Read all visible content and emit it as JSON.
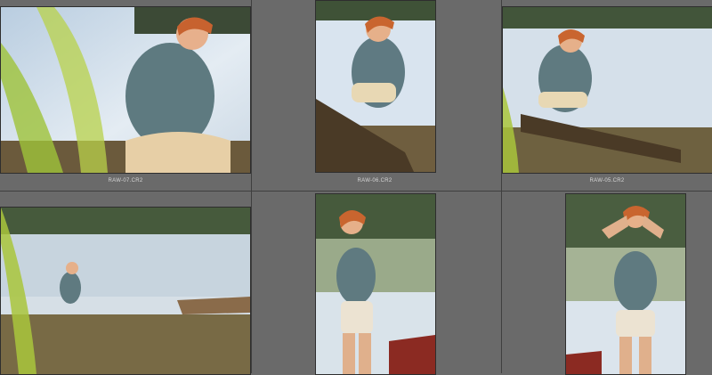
{
  "grid": {
    "background_color": "#6a6a6a",
    "separator_color": "#3f3f3f",
    "cells": [
      {
        "filename": "RAW-07.CR2",
        "orientation": "landscape",
        "selected": false
      },
      {
        "filename": "RAW-06.CR2",
        "orientation": "landscape",
        "selected": false
      },
      {
        "filename": "RAW-05.CR2",
        "orientation": "landscape",
        "selected": false
      },
      {
        "filename": "",
        "orientation": "landscape",
        "selected": false
      },
      {
        "filename": "",
        "orientation": "portrait",
        "selected": false
      },
      {
        "filename": "",
        "orientation": "portrait",
        "selected": false
      }
    ]
  }
}
